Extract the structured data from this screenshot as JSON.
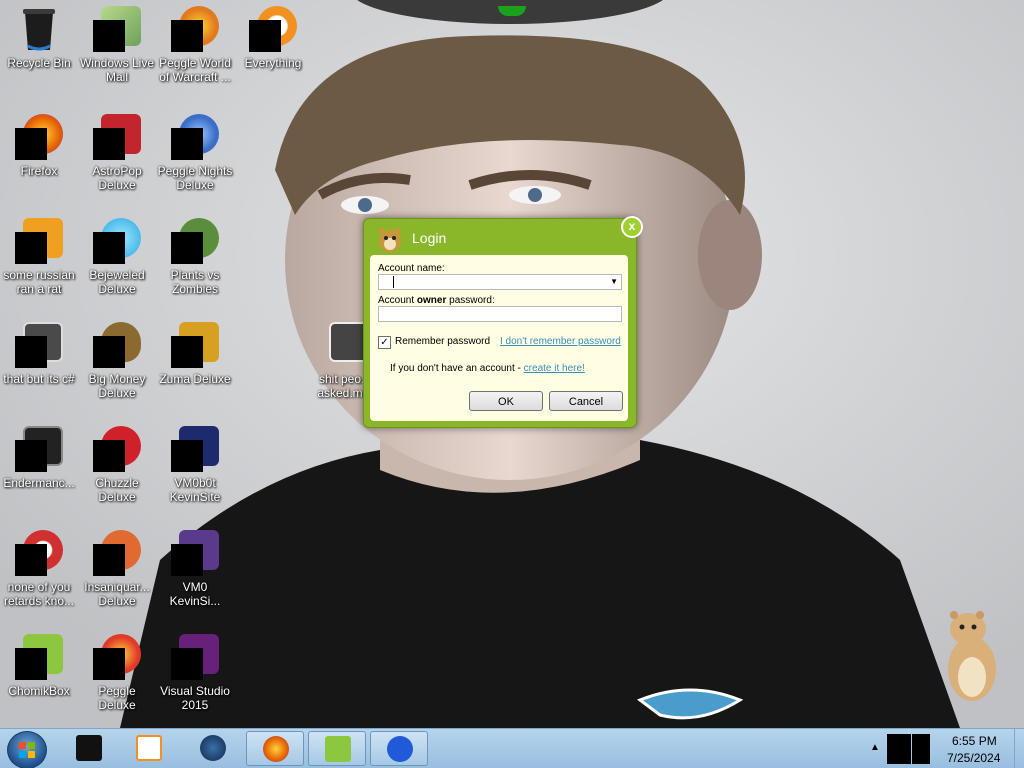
{
  "desktop": {
    "icons": [
      {
        "label": "Recycle Bin",
        "icon": "recycle-bin-icon",
        "color": "#2a2a2a"
      },
      {
        "label": "Windows Live Mail",
        "icon": "windows-live-mail-icon",
        "color": "#6fa15a"
      },
      {
        "label": "Peggle World of Warcraft ...",
        "icon": "peggle-wow-icon",
        "color": "#e07a1c"
      },
      {
        "label": "Everything",
        "icon": "everything-icon",
        "color": "#f29020"
      },
      {
        "label": "Firefox",
        "icon": "firefox-icon",
        "color": "#e66000"
      },
      {
        "label": "AstroPop Deluxe",
        "icon": "astropop-icon",
        "color": "#c2262c"
      },
      {
        "label": "Peggle Nights Deluxe",
        "icon": "peggle-nights-icon",
        "color": "#3a6fc7"
      },
      {
        "label": "some russian ran a rat",
        "icon": "rat-icon",
        "color": "#f0a020"
      },
      {
        "label": "Bejeweled Deluxe",
        "icon": "bejeweled-icon",
        "color": "#2aa7e0"
      },
      {
        "label": "Plants vs Zombies",
        "icon": "plants-vs-zombies-icon",
        "color": "#5b8e3c"
      },
      {
        "label": "that but its c#",
        "icon": "shortcut-icon",
        "color": "#4a4a4a"
      },
      {
        "label": "Big Money Deluxe",
        "icon": "big-money-icon",
        "color": "#8a6a30"
      },
      {
        "label": "Zuma Deluxe",
        "icon": "zuma-icon",
        "color": "#d8a020"
      },
      {
        "label": "Endermanc...",
        "icon": "enderman-icon",
        "color": "#222222"
      },
      {
        "label": "Chuzzle Deluxe",
        "icon": "chuzzle-icon",
        "color": "#d0202a"
      },
      {
        "label": "VM0b0t KevinSite",
        "icon": "vm-icon",
        "color": "#1e2a6e"
      },
      {
        "label": "none of you retards kno...",
        "icon": "app-icon",
        "color": "#d03030"
      },
      {
        "label": "Insaniquar... Deluxe",
        "icon": "insaniquarium-icon",
        "color": "#e06a30"
      },
      {
        "label": "VM0 KevinSi...",
        "icon": "vm-icon-2",
        "color": "#5a3a8a"
      },
      {
        "label": "ChomikBox",
        "icon": "chomikbox-icon",
        "color": "#8dc63f"
      },
      {
        "label": "Peggle Deluxe",
        "icon": "peggle-deluxe-icon",
        "color": "#e03a2a"
      },
      {
        "label": "Visual Studio 2015",
        "icon": "visual-studio-icon",
        "color": "#68217a"
      },
      {
        "label": "shit peo... asked.m...",
        "icon": "file-icon",
        "color": "#444444"
      }
    ]
  },
  "login_dialog": {
    "title": "Login",
    "close_label": "x",
    "account_name_label": "Account name:",
    "account_name_value": "",
    "password_label_prefix": "Account ",
    "password_label_bold": "owner",
    "password_label_suffix": " password:",
    "password_value": "",
    "remember_label": "Remember password",
    "remember_checked": true,
    "checkmark": "✓",
    "forgot_link": "I don't remember password",
    "signup_text": "If you don't have an account - ",
    "signup_link": "create it here!",
    "ok_label": "OK",
    "cancel_label": "Cancel",
    "accent_color": "#8ab72a"
  },
  "taskbar": {
    "items": [
      {
        "name": "taskbar-item-app-1",
        "icon": "black-box-icon",
        "active": false
      },
      {
        "name": "taskbar-item-media-player",
        "icon": "media-player-icon",
        "active": false
      },
      {
        "name": "taskbar-item-app-3",
        "icon": "globe-icon",
        "active": false
      },
      {
        "name": "taskbar-item-firefox",
        "icon": "firefox-icon",
        "active": true
      },
      {
        "name": "taskbar-item-chomikbox",
        "icon": "chomikbox-icon",
        "active": true
      },
      {
        "name": "taskbar-item-malwarebytes",
        "icon": "malwarebytes-icon",
        "active": true
      }
    ],
    "show_hidden_icons": "▲",
    "clock_time": "6:55 PM",
    "clock_date": "7/25/2024"
  }
}
